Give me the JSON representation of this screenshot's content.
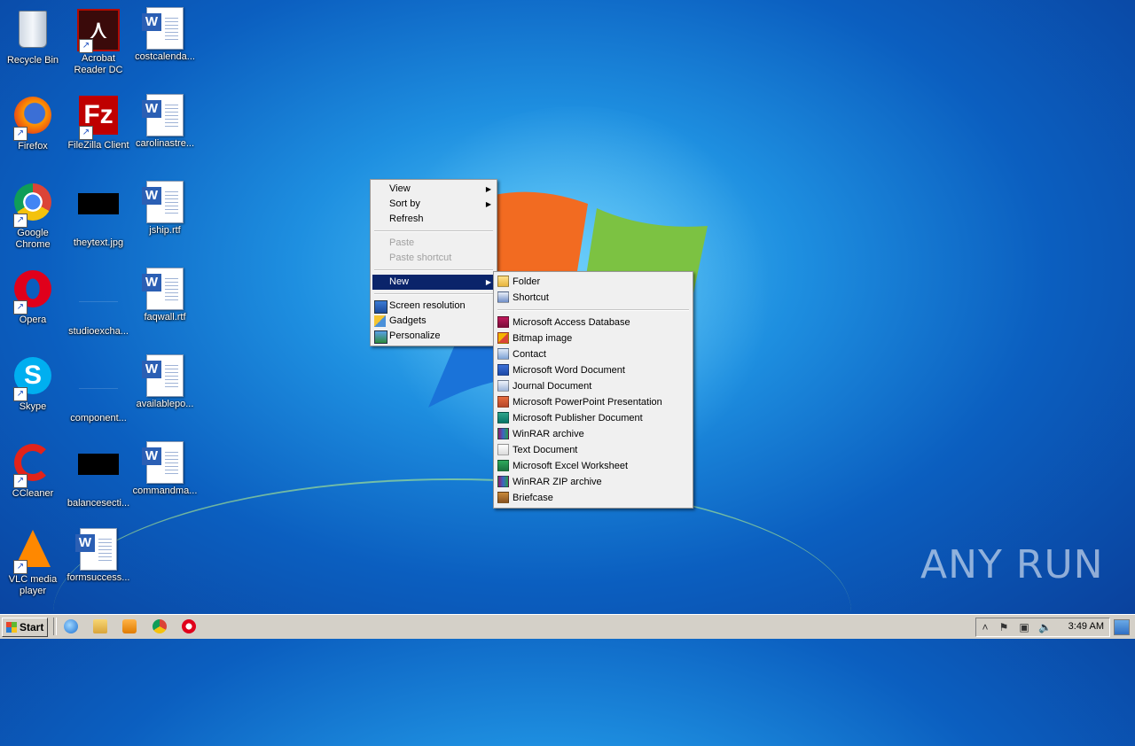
{
  "desktop": {
    "icons": [
      {
        "label": "Recycle Bin",
        "kind": "recycle-bin-icon"
      },
      {
        "label": "Acrobat Reader DC",
        "kind": "acrobat-icon"
      },
      {
        "label": "costcalenda...",
        "kind": "word-document-icon"
      },
      {
        "label": "Firefox",
        "kind": "firefox-icon"
      },
      {
        "label": "FileZilla Client",
        "kind": "filezilla-icon"
      },
      {
        "label": "carolinastre...",
        "kind": "word-document-icon"
      },
      {
        "label": "Google Chrome",
        "kind": "chrome-icon"
      },
      {
        "label": "theytext.jpg",
        "kind": "image-file-icon"
      },
      {
        "label": "jship.rtf",
        "kind": "word-document-icon"
      },
      {
        "label": "Opera",
        "kind": "opera-icon"
      },
      {
        "label": "studioexcha...",
        "kind": "blank-file-icon"
      },
      {
        "label": "faqwall.rtf",
        "kind": "word-document-icon"
      },
      {
        "label": "Skype",
        "kind": "skype-icon"
      },
      {
        "label": "component...",
        "kind": "blank-file-icon"
      },
      {
        "label": "availablepo...",
        "kind": "word-document-icon"
      },
      {
        "label": "CCleaner",
        "kind": "ccleaner-icon"
      },
      {
        "label": "balancesecti...",
        "kind": "image-file-icon"
      },
      {
        "label": "commandma...",
        "kind": "word-document-icon"
      },
      {
        "label": "VLC media player",
        "kind": "vlc-icon"
      },
      {
        "label": "formsuccess...",
        "kind": "word-document-icon"
      }
    ]
  },
  "context_menu": {
    "items": [
      {
        "label": "View",
        "submenu": true
      },
      {
        "label": "Sort by",
        "submenu": true
      },
      {
        "label": "Refresh"
      },
      {
        "label": "Paste",
        "disabled": true
      },
      {
        "label": "Paste shortcut",
        "disabled": true
      },
      {
        "label": "New",
        "submenu": true,
        "selected": true
      },
      {
        "label": "Screen resolution",
        "icon": "screen-resolution-icon"
      },
      {
        "label": "Gadgets",
        "icon": "gadgets-icon"
      },
      {
        "label": "Personalize",
        "icon": "personalize-icon"
      }
    ]
  },
  "new_submenu": {
    "items": [
      {
        "label": "Folder",
        "icon": "folder-icon"
      },
      {
        "label": "Shortcut",
        "icon": "shortcut-icon"
      },
      {
        "label": "Microsoft Access Database",
        "icon": "access-icon"
      },
      {
        "label": "Bitmap image",
        "icon": "bitmap-icon"
      },
      {
        "label": "Contact",
        "icon": "contact-icon"
      },
      {
        "label": "Microsoft Word Document",
        "icon": "word-icon"
      },
      {
        "label": "Journal Document",
        "icon": "journal-icon"
      },
      {
        "label": "Microsoft PowerPoint Presentation",
        "icon": "powerpoint-icon"
      },
      {
        "label": "Microsoft Publisher Document",
        "icon": "publisher-icon"
      },
      {
        "label": "WinRAR archive",
        "icon": "winrar-icon"
      },
      {
        "label": "Text Document",
        "icon": "text-document-icon"
      },
      {
        "label": "Microsoft Excel Worksheet",
        "icon": "excel-icon"
      },
      {
        "label": "WinRAR ZIP archive",
        "icon": "winrar-zip-icon"
      },
      {
        "label": "Briefcase",
        "icon": "briefcase-icon"
      }
    ]
  },
  "taskbar": {
    "start_label": "Start",
    "quick_launch": [
      "internet-explorer-icon",
      "explorer-icon",
      "media-player-icon",
      "chrome-icon",
      "opera-icon"
    ],
    "clock": "3:49 AM"
  },
  "watermark": "ANY RUN",
  "colors": {
    "menu_highlight": "#0a246a",
    "taskbar": "#d4d0c8",
    "menu_bg": "#f0f0f0"
  }
}
